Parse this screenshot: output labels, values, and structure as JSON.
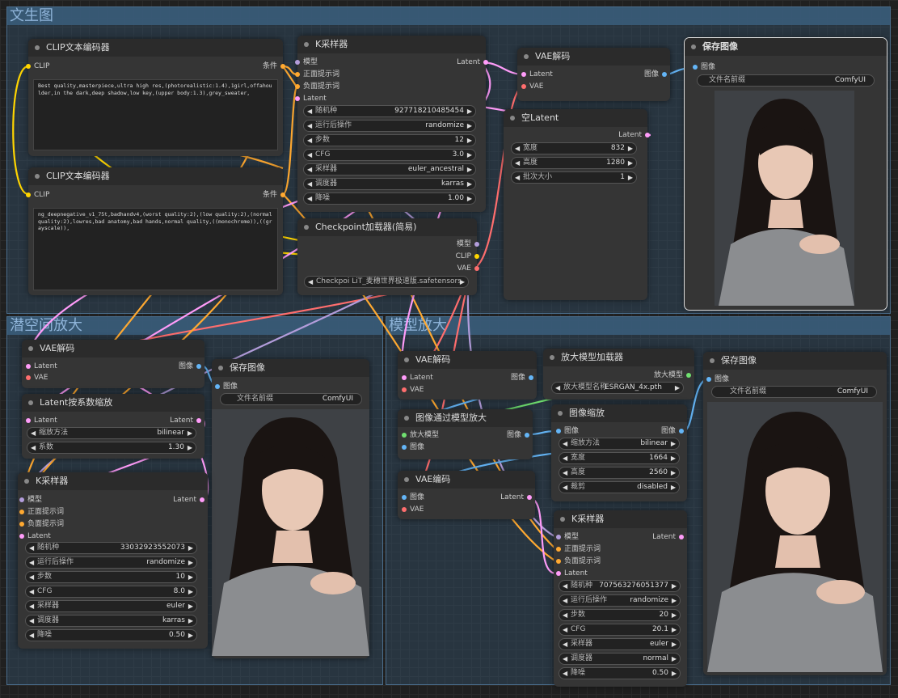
{
  "groups": {
    "txt2img": "文生图",
    "latent_up": "潜空间放大",
    "model_up": "模型放大"
  },
  "labels": {
    "clip": "CLIP",
    "cond": "条件",
    "model": "模型",
    "pos": "正面提示词",
    "neg": "负面提示词",
    "latent": "Latent",
    "vae": "VAE",
    "image": "图像",
    "upscale_model": "放大模型"
  },
  "clip1": {
    "title": "CLIP文本编码器",
    "text": "Best quality,masterpiece,ultra high res,(photorealistic:1.4),1girl,offahoulder,in the dark,deep shadow,low key,(upper body:1.3),grey_sweater,"
  },
  "clip2": {
    "title": "CLIP文本编码器",
    "text": "ng_deepnegative_v1_75t,badhandv4,(worst quality:2),(low quality:2),(normal quality:2),lowres,bad anatomy,bad hands,normal quality,((monochrome)),((grayscale)),"
  },
  "ks1": {
    "title": "K采样器",
    "seed": [
      "随机种",
      "927718210485454"
    ],
    "after": [
      "运行后操作",
      "randomize"
    ],
    "steps": [
      "步数",
      "12"
    ],
    "cfg": [
      "CFG",
      "3.0"
    ],
    "sampler": [
      "采样器",
      "euler_ancestral"
    ],
    "sched": [
      "调度器",
      "karras"
    ],
    "denoise": [
      "降噪",
      "1.00"
    ]
  },
  "ckpt": {
    "title": "Checkpoint加载器(简易)",
    "value": "Checkpoi LiT_麦穗世界极速版.safetensors"
  },
  "vaedec1": {
    "title": "VAE解码"
  },
  "empty": {
    "title": "空Latent",
    "width": [
      "宽度",
      "832"
    ],
    "height": [
      "高度",
      "1280"
    ],
    "batch": [
      "批次大小",
      "1"
    ]
  },
  "save1": {
    "title": "保存图像",
    "prefix": [
      "文件名前缀",
      "ComfyUI"
    ]
  },
  "vaedec2": {
    "title": "VAE解码"
  },
  "save2": {
    "title": "保存图像",
    "prefix": [
      "文件名前缀",
      "ComfyUI"
    ]
  },
  "lscale": {
    "title": "Latent按系数缩放",
    "method": [
      "缩放方法",
      "bilinear"
    ],
    "factor": [
      "系数",
      "1.30"
    ]
  },
  "ks2": {
    "title": "K采样器",
    "seed": [
      "随机种",
      "33032923552073"
    ],
    "after": [
      "运行后操作",
      "randomize"
    ],
    "steps": [
      "步数",
      "10"
    ],
    "cfg": [
      "CFG",
      "8.0"
    ],
    "sampler": [
      "采样器",
      "euler"
    ],
    "sched": [
      "调度器",
      "karras"
    ],
    "denoise": [
      "降噪",
      "0.50"
    ]
  },
  "vaedec3": {
    "title": "VAE解码"
  },
  "uploader": {
    "title": "放大模型加载器",
    "name": [
      "放大模型名称",
      "ESRGAN_4x.pth"
    ]
  },
  "save3": {
    "title": "保存图像",
    "prefix": [
      "文件名前缀",
      "ComfyUI"
    ]
  },
  "imgup": {
    "title": "图像通过模型放大"
  },
  "imgscale": {
    "title": "图像缩放",
    "method": [
      "缩放方法",
      "bilinear"
    ],
    "width": [
      "宽度",
      "1664"
    ],
    "height": [
      "高度",
      "2560"
    ],
    "crop": [
      "裁剪",
      "disabled"
    ]
  },
  "vaeenc": {
    "title": "VAE编码"
  },
  "ks3": {
    "title": "K采样器",
    "seed": [
      "随机种",
      "707563276051377"
    ],
    "after": [
      "运行后操作",
      "randomize"
    ],
    "steps": [
      "步数",
      "20"
    ],
    "cfg": [
      "CFG",
      "20.1"
    ],
    "sampler": [
      "采样器",
      "euler"
    ],
    "sched": [
      "调度器",
      "normal"
    ],
    "denoise": [
      "降噪",
      "0.50"
    ]
  },
  "colors": {
    "model": "#b39ddb",
    "clip": "#ffd500",
    "conditioning": "#ffa931",
    "latent": "#ff9cf9",
    "vae": "#ff6e6e",
    "image": "#64b5f6",
    "group": "#3a5e7d"
  }
}
